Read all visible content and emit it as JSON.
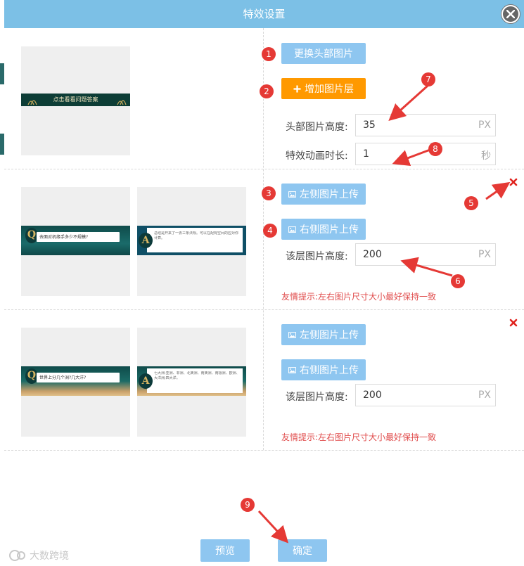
{
  "dialog": {
    "title": "特效设置"
  },
  "header_section": {
    "replace_button": "更换头部图片",
    "add_layer_button": "增加图片层",
    "banner_text": "点击看看问题答案",
    "height_label": "头部图片高度:",
    "height_value": "35",
    "height_unit": "PX",
    "duration_label": "特效动画时长:",
    "duration_value": "1",
    "duration_unit": "秒"
  },
  "layers": [
    {
      "left_upload": "左侧图片上传",
      "right_upload": "右侧图片上传",
      "height_label": "该层图片高度:",
      "height_value": "200",
      "height_unit": "PX",
      "hint": "友情提示:左右图片尺寸大小最好保持一致",
      "q_letter": "Q",
      "a_letter": "A",
      "q_text": "去面对机缘手多少不规模?",
      "a_text": "总结是开来了一去三条法规。可以在配有空间的应对你计算。"
    },
    {
      "left_upload": "左侧图片上传",
      "right_upload": "右侧图片上传",
      "height_label": "该层图片高度:",
      "height_value": "200",
      "height_unit": "PX",
      "hint": "友情提示:左右图片尺寸大小最好保持一致",
      "q_letter": "Q",
      "a_letter": "A",
      "q_text": "世界上分几个洲?几大洋?",
      "a_text": "七大洲:亚洲、非洲、北美洲、南美洲、南极洲、欧洲、大洋洲;四大洋。"
    }
  ],
  "footer": {
    "preview_button": "预览",
    "confirm_button": "确定"
  },
  "annotations": [
    "1",
    "2",
    "3",
    "4",
    "5",
    "6",
    "7",
    "8",
    "9"
  ],
  "watermark": "大数跨境",
  "colors": {
    "header_bg": "#7cc0e6",
    "button_blue": "#8ec6f0",
    "button_orange": "#ff9900",
    "hint_red": "#e04b4b",
    "annotation_red": "#e53935"
  }
}
